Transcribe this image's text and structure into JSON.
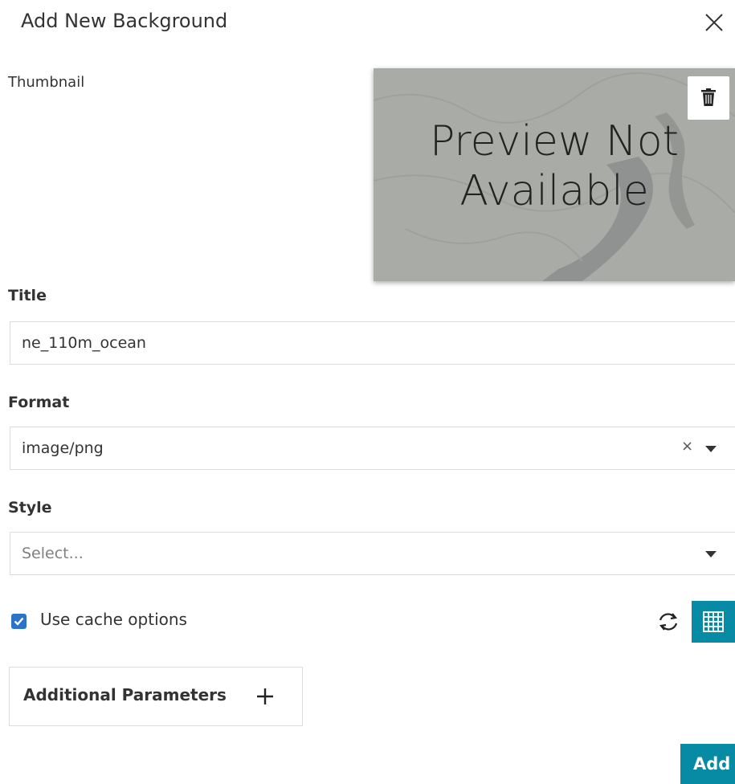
{
  "dialog": {
    "title": "Add New Background"
  },
  "thumbnail": {
    "label": "Thumbnail",
    "preview_line1": "Preview Not",
    "preview_line2": "Available"
  },
  "title_field": {
    "label": "Title",
    "value": "ne_110m_ocean"
  },
  "format_field": {
    "label": "Format",
    "value": "image/png",
    "clear_symbol": "×"
  },
  "style_field": {
    "label": "Style",
    "placeholder": "Select..."
  },
  "cache": {
    "label": "Use cache options",
    "checked": true
  },
  "params": {
    "label": "Additional Parameters"
  },
  "actions": {
    "add_label": "Add"
  },
  "colors": {
    "accent": "#078aa3",
    "checkbox": "#2a73c9",
    "border": "#dcdcdc"
  },
  "icons": [
    "close-icon",
    "trash-icon",
    "clear-icon",
    "chevron-down-icon",
    "refresh-icon",
    "grid-icon",
    "plus-icon",
    "check-icon"
  ]
}
